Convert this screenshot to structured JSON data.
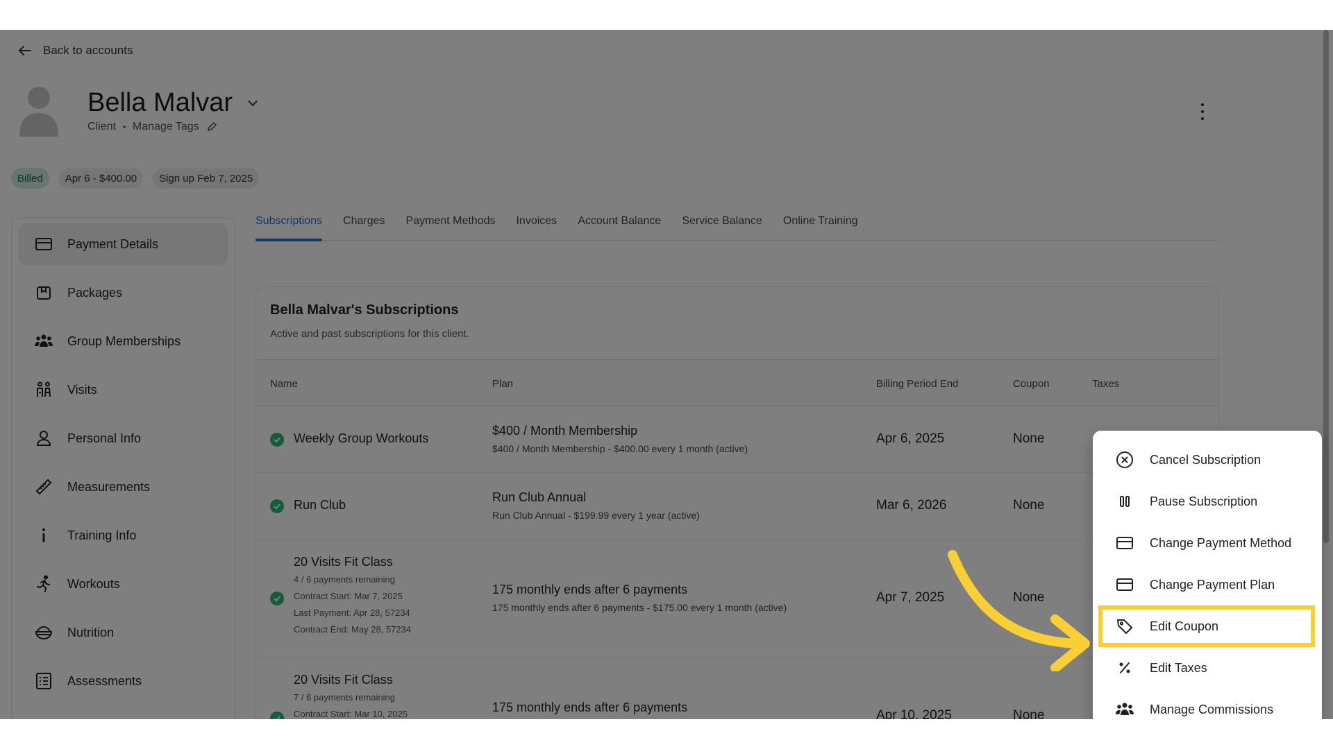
{
  "nav": {
    "back_label": "Back to accounts"
  },
  "client": {
    "name": "Bella Malvar",
    "role": "Client",
    "manage_tags": "Manage Tags"
  },
  "badges": {
    "status": "Billed",
    "next_bill": "Apr 6 - $400.00",
    "signup": "Sign up Feb 7, 2025",
    "status_color": "#cfeee0"
  },
  "sidebar": {
    "items": [
      {
        "label": "Payment Details",
        "icon": "credit-card-icon",
        "active": true
      },
      {
        "label": "Packages",
        "icon": "package-icon"
      },
      {
        "label": "Group Memberships",
        "icon": "group-icon"
      },
      {
        "label": "Visits",
        "icon": "people-icon"
      },
      {
        "label": "Personal Info",
        "icon": "person-icon"
      },
      {
        "label": "Measurements",
        "icon": "ruler-icon"
      },
      {
        "label": "Training Info",
        "icon": "info-icon"
      },
      {
        "label": "Workouts",
        "icon": "running-icon"
      },
      {
        "label": "Nutrition",
        "icon": "bowl-icon"
      },
      {
        "label": "Assessments",
        "icon": "checklist-icon"
      }
    ]
  },
  "tabs": [
    {
      "label": "Subscriptions",
      "active": true
    },
    {
      "label": "Charges"
    },
    {
      "label": "Payment Methods"
    },
    {
      "label": "Invoices"
    },
    {
      "label": "Account Balance"
    },
    {
      "label": "Service Balance"
    },
    {
      "label": "Online Training"
    }
  ],
  "subscriptions": {
    "title": "Bella Malvar's Subscriptions",
    "subtitle": "Active and past subscriptions for this client.",
    "columns": {
      "name": "Name",
      "plan": "Plan",
      "billing_end": "Billing Period End",
      "coupon": "Coupon",
      "taxes": "Taxes"
    },
    "rows": [
      {
        "name": "Weekly Group Workouts",
        "plan": "$400 / Month Membership",
        "plan_detail": "$400 / Month Membership - $400.00 every 1 month (active)",
        "billing_end": "Apr 6, 2025",
        "coupon": "None"
      },
      {
        "name": "Run Club",
        "plan": "Run Club Annual",
        "plan_detail": "Run Club Annual - $199.99 every 1 year (active)",
        "billing_end": "Mar 6, 2026",
        "coupon": "None"
      },
      {
        "name": "20 Visits Fit Class",
        "meta": [
          "4 / 6 payments remaining",
          "Contract Start: Mar 7, 2025",
          "Last Payment: Apr 28, 57234",
          "Contract End: May 28, 57234"
        ],
        "plan": "175 monthly ends after 6 payments",
        "plan_detail": "175 monthly ends after 6 payments - $175.00 every 1 month (active)",
        "billing_end": "Apr 7, 2025",
        "coupon": "None"
      },
      {
        "name": "20 Visits Fit Class",
        "meta": [
          "7 / 6 payments remaining",
          "Contract Start: Mar 10, 2025"
        ],
        "plan": "175 monthly ends after 6 payments",
        "billing_end": "Apr 10, 2025",
        "coupon": "None"
      }
    ]
  },
  "menu": {
    "items": [
      {
        "label": "Cancel Subscription",
        "icon": "circle-x-icon"
      },
      {
        "label": "Pause Subscription",
        "icon": "pause-icon"
      },
      {
        "label": "Change Payment Method",
        "icon": "credit-card-icon"
      },
      {
        "label": "Change Payment Plan",
        "icon": "credit-card-icon"
      },
      {
        "label": "Edit Coupon",
        "icon": "tag-icon",
        "highlighted": true
      },
      {
        "label": "Edit Taxes",
        "icon": "percent-icon"
      },
      {
        "label": "Manage Commissions",
        "icon": "group-icon"
      }
    ],
    "highlight_color": "#f9cf35"
  }
}
